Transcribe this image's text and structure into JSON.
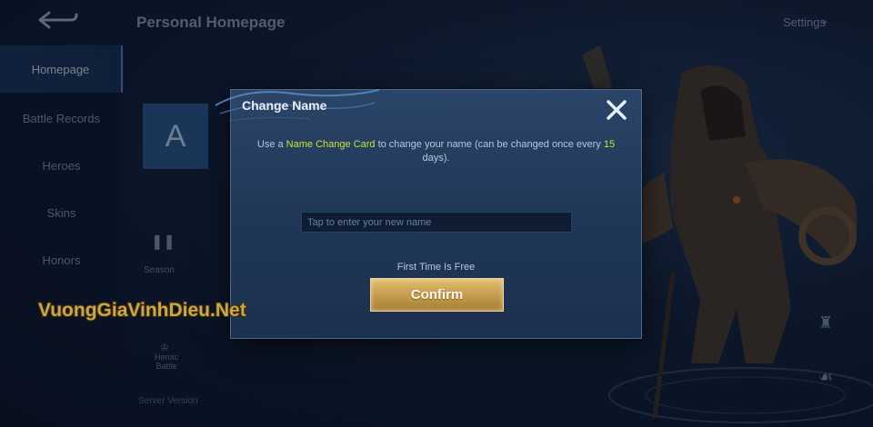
{
  "header": {
    "back_icon": "back-arrow-icon",
    "title": "Personal Homepage",
    "settings_label": "Settings",
    "settings_icon": "chevron-down-icon"
  },
  "sidebar": {
    "items": [
      {
        "label": "Homepage",
        "active": true
      },
      {
        "label": "Battle Records",
        "active": false
      },
      {
        "label": "Heroes",
        "active": false
      },
      {
        "label": "Skins",
        "active": false
      },
      {
        "label": "Honors",
        "active": false
      }
    ]
  },
  "profile": {
    "avatar_letter": "A",
    "stat_label": "Season",
    "stat_label2": "Heroic Battle"
  },
  "footer": {
    "version": "Server Version"
  },
  "dialog": {
    "title": "Change Name",
    "close_icon": "close-icon",
    "desc_prefix": "Use a ",
    "desc_card": "Name Change Card",
    "desc_middle": " to change your name (can be changed once every ",
    "desc_days": "15",
    "desc_suffix": " days).",
    "input_placeholder": "Tap to enter your new name",
    "input_value": "",
    "free_note": "First Time Is Free",
    "confirm_label": "Confirm"
  },
  "watermark": "VuongGiaVinhDieu.Net",
  "colors": {
    "highlight": "#c7e23b",
    "confirm_gold": "#c39a4c",
    "dialog_bg": "#1f3656",
    "watermark": "#c9a74a"
  }
}
